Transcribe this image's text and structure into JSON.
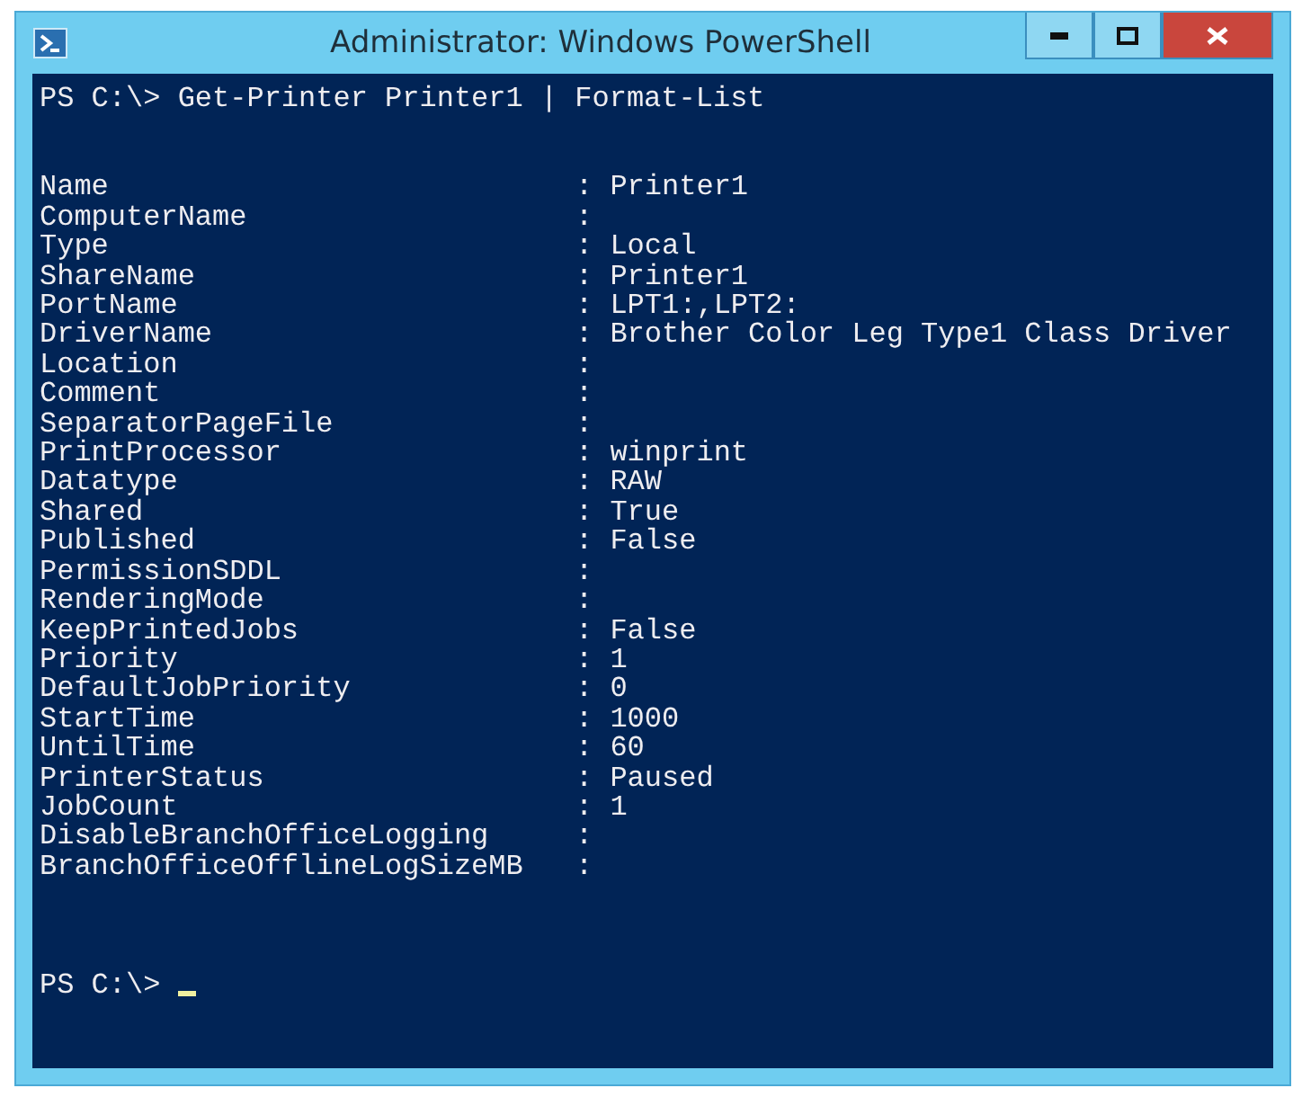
{
  "window": {
    "title": "Administrator: Windows PowerShell"
  },
  "console": {
    "command": "PS C:\\> Get-Printer Printer1 | Format-List",
    "properties": [
      {
        "name": "Name",
        "value": ": Printer1"
      },
      {
        "name": "ComputerName",
        "value": ":"
      },
      {
        "name": "Type",
        "value": ": Local"
      },
      {
        "name": "ShareName",
        "value": ": Printer1"
      },
      {
        "name": "PortName",
        "value": ": LPT1:,LPT2:"
      },
      {
        "name": "DriverName",
        "value": ": Brother Color Leg Type1 Class Driver"
      },
      {
        "name": "Location",
        "value": ":"
      },
      {
        "name": "Comment",
        "value": ":"
      },
      {
        "name": "SeparatorPageFile",
        "value": ":"
      },
      {
        "name": "PrintProcessor",
        "value": ": winprint"
      },
      {
        "name": "Datatype",
        "value": ": RAW"
      },
      {
        "name": "Shared",
        "value": ": True"
      },
      {
        "name": "Published",
        "value": ": False"
      },
      {
        "name": "PermissionSDDL",
        "value": ":"
      },
      {
        "name": "RenderingMode",
        "value": ":"
      },
      {
        "name": "KeepPrintedJobs",
        "value": ": False"
      },
      {
        "name": "Priority",
        "value": ": 1"
      },
      {
        "name": "DefaultJobPriority",
        "value": ": 0"
      },
      {
        "name": "StartTime",
        "value": ": 1000"
      },
      {
        "name": "UntilTime",
        "value": ": 60"
      },
      {
        "name": "PrinterStatus",
        "value": ": Paused"
      },
      {
        "name": "JobCount",
        "value": ": 1"
      },
      {
        "name": "DisableBranchOfficeLogging",
        "value": ":"
      },
      {
        "name": "BranchOfficeOfflineLogSizeMB",
        "value": ":"
      }
    ],
    "prompt": "PS C:\\>"
  }
}
